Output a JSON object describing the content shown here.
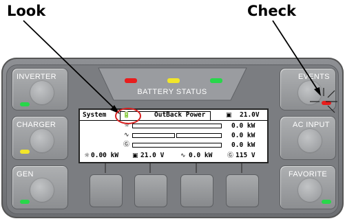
{
  "callouts": {
    "look": "Look",
    "check": "Check"
  },
  "panel": {
    "left_buttons": [
      {
        "label": "INVERTER",
        "led": "green"
      },
      {
        "label": "CHARGER",
        "led": "yellow"
      },
      {
        "label": "GEN",
        "led": "green"
      }
    ],
    "right_buttons": [
      {
        "label": "EVENTS",
        "led": "red"
      },
      {
        "label": "AC INPUT",
        "led": "none"
      },
      {
        "label": "FAVORITE",
        "led": "green"
      }
    ],
    "battery_status": {
      "label": "BATTERY STATUS",
      "leds": [
        "red",
        "yellow",
        "green"
      ]
    },
    "soft_keys": 4
  },
  "lcd": {
    "system_label": "System",
    "device_name": "OutBack Power",
    "battery_voltage_top": "21.0V",
    "rows": [
      {
        "icon": "sun-icon",
        "value": "0.0 kW"
      },
      {
        "icon": "ac-wave-icon",
        "value": "0.0 kW"
      },
      {
        "icon": "generator-icon",
        "value": "0.0 kW"
      }
    ],
    "bottom": {
      "solar": "0.00 kW",
      "battery": "21.0 V",
      "ac": "0.0 kW",
      "gen": "115 V"
    }
  },
  "colors": {
    "led_red": "#e81d1d",
    "led_yellow": "#f2e629",
    "led_green": "#28d74a",
    "panel": "#7b7d81",
    "highlight_circle": "#d62020"
  }
}
